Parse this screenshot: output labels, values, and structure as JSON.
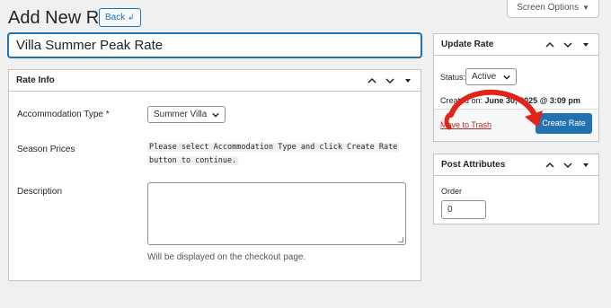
{
  "header": {
    "title": "Add New Rate",
    "back_label": "Back",
    "screen_options_label": "Screen Options"
  },
  "title_input": {
    "value": "Villa Summer Peak Rate"
  },
  "rate_info": {
    "title": "Rate Info",
    "accommodation_label": "Accommodation Type",
    "required_mark": "*",
    "accommodation_value": "Summer Villa",
    "season_prices_label": "Season Prices",
    "season_note_line1": "Please select Accommodation Type and click Create Rate",
    "season_note_line2": "button to continue.",
    "description_label": "Description",
    "description_hint": "Will be displayed on the checkout page."
  },
  "update_rate": {
    "title": "Update Rate",
    "status_label": "Status:",
    "status_value": "Active",
    "created_prefix": "Created on:",
    "created_value": "June 30, 2025 @ 3:09 pm",
    "trash_label": "Move to Trash",
    "create_label": "Create Rate"
  },
  "post_attributes": {
    "title": "Post Attributes",
    "order_label": "Order",
    "order_value": "0"
  },
  "colors": {
    "accent": "#2271b1",
    "annotation_arrow": "#e2231a",
    "trash": "#b32d2e"
  }
}
